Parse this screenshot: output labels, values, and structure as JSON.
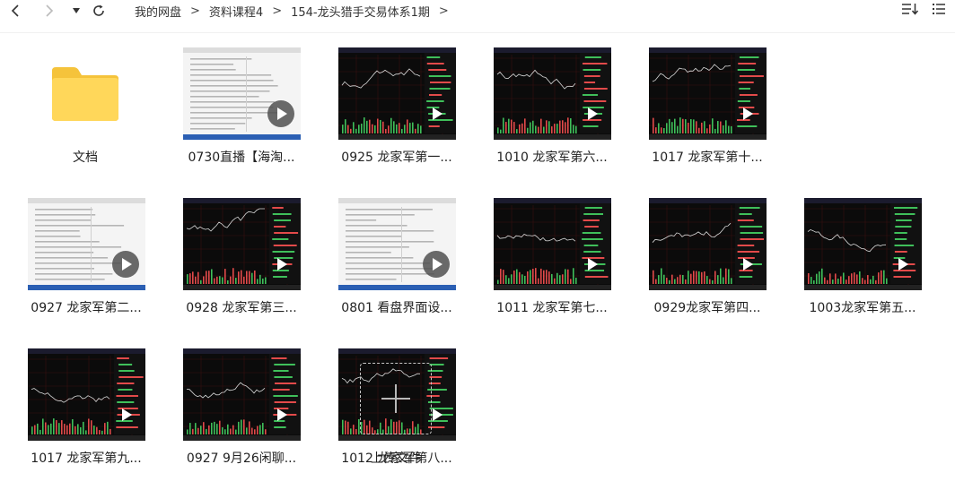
{
  "nav": {
    "breadcrumbs": [
      "我的网盘",
      "资料课程4",
      "154-龙头猎手交易体系1期"
    ]
  },
  "folder": {
    "label": "文档"
  },
  "videos": [
    {
      "label": "0730直播【海淘...",
      "style": "light"
    },
    {
      "label": "0925 龙家军第一...",
      "style": "dark"
    },
    {
      "label": "1010 龙家军第六...",
      "style": "dark"
    },
    {
      "label": "1017 龙家军第十...",
      "style": "dark"
    },
    {
      "label": "0927 龙家军第二...",
      "style": "light"
    },
    {
      "label": "0928 龙家军第三...",
      "style": "dark"
    },
    {
      "label": "0801 看盘界面设...",
      "style": "light"
    },
    {
      "label": "1011 龙家军第七...",
      "style": "dark"
    },
    {
      "label": "0929龙家军第四...",
      "style": "dark"
    },
    {
      "label": "1003龙家军第五...",
      "style": "dark"
    },
    {
      "label": "1017 龙家军第九...",
      "style": "dark"
    },
    {
      "label": "0927 9月26闲聊...",
      "style": "dark"
    },
    {
      "label": "1012 龙家军第八...",
      "style": "dark"
    }
  ],
  "upload": {
    "label": "上传文件"
  }
}
